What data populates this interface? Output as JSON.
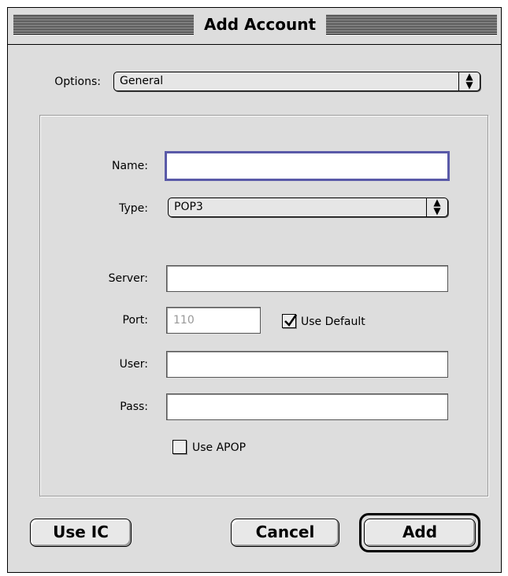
{
  "window": {
    "title": "Add Account"
  },
  "options": {
    "label": "Options:",
    "value": "General"
  },
  "form": {
    "name_label": "Name:",
    "name_value": "",
    "type_label": "Type:",
    "type_value": "POP3",
    "server_label": "Server:",
    "server_value": "",
    "port_label": "Port:",
    "port_value": "110",
    "use_default_label": "Use Default",
    "use_default_checked": true,
    "user_label": "User:",
    "user_value": "",
    "pass_label": "Pass:",
    "pass_value": "",
    "use_apop_label": "Use APOP",
    "use_apop_checked": false
  },
  "buttons": {
    "use_ic": "Use IC",
    "cancel": "Cancel",
    "add": "Add"
  },
  "icons": {
    "popup_arrows": "updown-arrows-icon",
    "checkmark": "checkmark-icon"
  },
  "colors": {
    "window_bg": "#dddddd",
    "focus_ring": "#5a5aa8"
  }
}
